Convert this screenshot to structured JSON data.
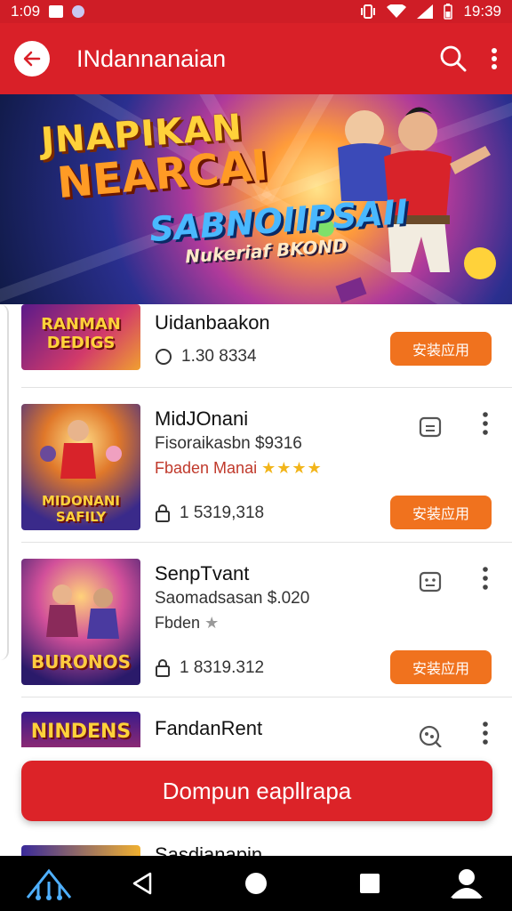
{
  "status_bar": {
    "time_left": "1:09",
    "time_right": "19:39"
  },
  "app_bar": {
    "title": "INdannanaian"
  },
  "banner": {
    "line1": "JNAPIKAN",
    "line2": "NEARCAI",
    "line3": "SABNOIIPSAII",
    "line4": "Nukeriaf BKOND"
  },
  "list": {
    "items": [
      {
        "thumb_text": "RANMAN DEDIGS",
        "title": "Uidanbaakon",
        "size": "1.30 8334",
        "install_label": "安装应用"
      },
      {
        "thumb_text": "MIDONANI SAFILY",
        "title": "MidJOnani",
        "meta": "Fisoraikasbn $9316",
        "developer": "Fbaden Manai",
        "rating_stars": "★★★★",
        "size": "1 5319,318",
        "install_label": "安装应用"
      },
      {
        "thumb_text": "BURONOS",
        "title": "SenpTvant",
        "meta": "Saomadsasan $.020",
        "developer": "Fbden",
        "rating_stars": "★",
        "size": "1 8319.312",
        "install_label": "安装应用"
      },
      {
        "thumb_text": "NINDENS",
        "title": "FandanRent"
      },
      {
        "title": "Sasdianapin"
      }
    ]
  },
  "primary_button": {
    "label": "Dompun eapllrapa"
  },
  "colors": {
    "brand_red": "#d92028",
    "install_orange": "#f0721e",
    "star_gold": "#f2b51b"
  }
}
